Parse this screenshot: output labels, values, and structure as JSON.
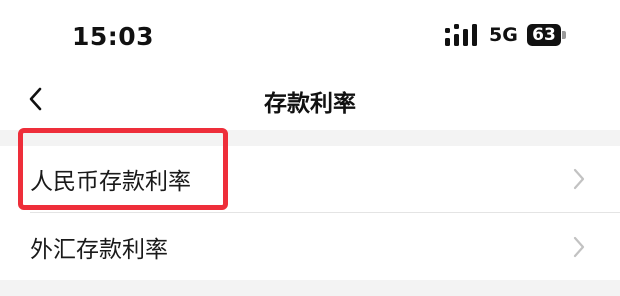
{
  "status": {
    "time": "15:03",
    "network": "5G",
    "battery": "63"
  },
  "nav": {
    "title": "存款利率",
    "back_icon": "chevron-left-icon"
  },
  "items": [
    {
      "label": "人民币存款利率",
      "icon": "chevron-right-icon",
      "highlighted": true
    },
    {
      "label": "外汇存款利率",
      "icon": "chevron-right-icon",
      "highlighted": false
    }
  ],
  "colors": {
    "highlight": "#ee2e3a",
    "band": "#f3f3f3"
  }
}
